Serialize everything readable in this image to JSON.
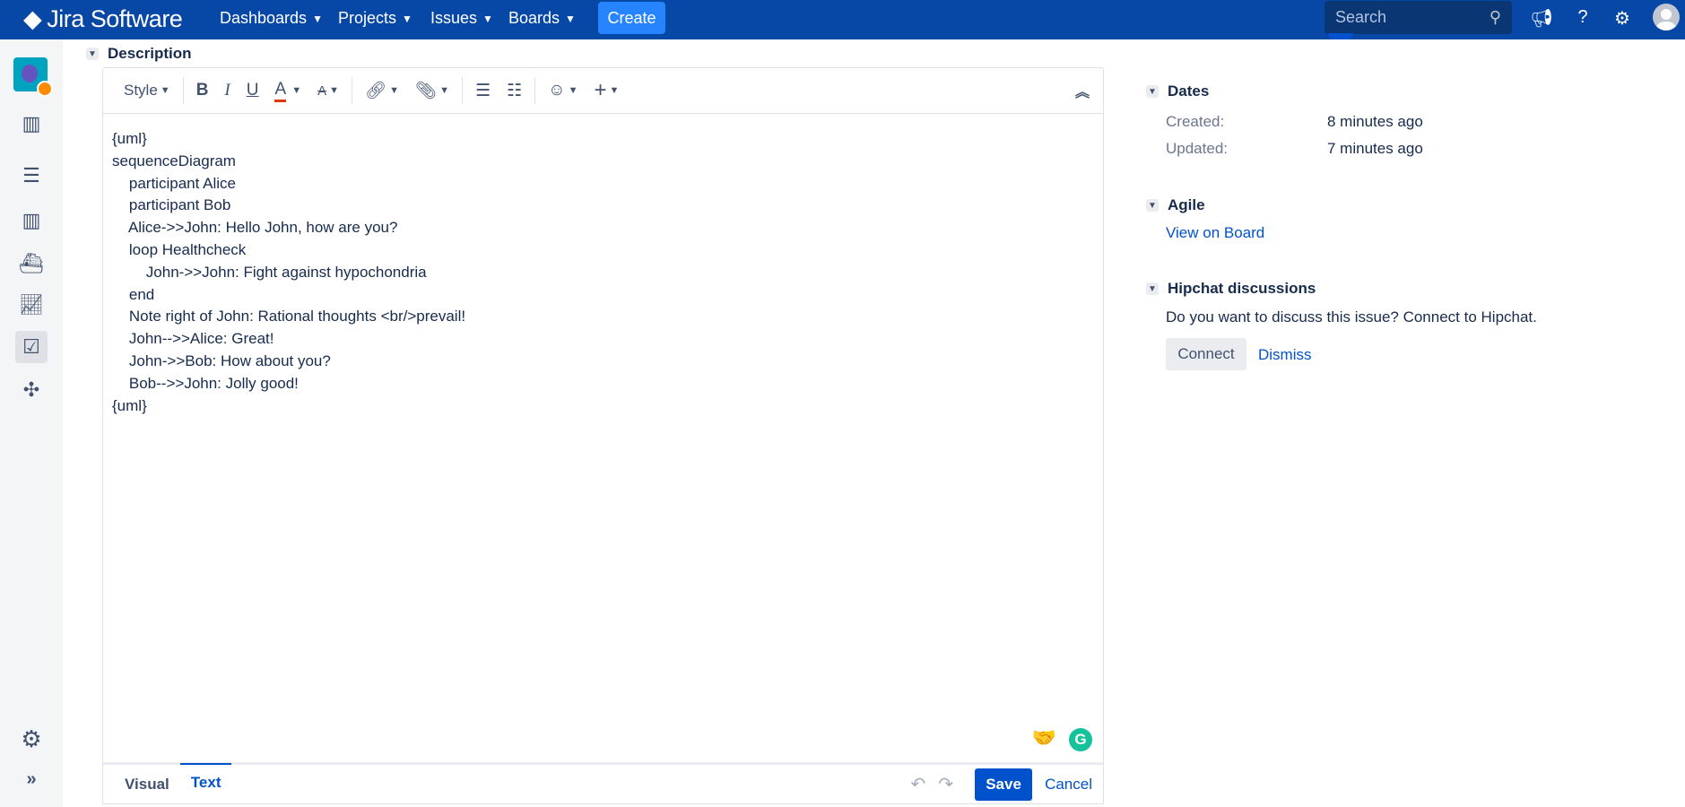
{
  "topbar": {
    "app_name": "Jira Software",
    "nav": [
      {
        "label": "Dashboards"
      },
      {
        "label": "Projects"
      },
      {
        "label": "Issues"
      },
      {
        "label": "Boards"
      }
    ],
    "create_label": "Create",
    "search_placeholder": "Search",
    "brand_color": "#0747a6"
  },
  "description": {
    "title": "Description"
  },
  "toolbar": {
    "style_label": "Style"
  },
  "editor": {
    "content": "{uml}\nsequenceDiagram\n    participant Alice\n    participant Bob\n    Alice->>John: Hello John, how are you?\n    loop Healthcheck\n        John->>John: Fight against hypochondria\n    end\n    Note right of John: Rational thoughts <br/>prevail!\n    John-->>Alice: Great!\n    John->>Bob: How about you?\n    Bob-->>John: Jolly good!\n{uml}",
    "modes": [
      "Visual",
      "Text"
    ],
    "active_mode": "Text",
    "save_label": "Save",
    "cancel_label": "Cancel"
  },
  "dates": {
    "title": "Dates",
    "created_label": "Created:",
    "created_value": "8 minutes ago",
    "updated_label": "Updated:",
    "updated_value": "7 minutes ago"
  },
  "agile": {
    "title": "Agile",
    "link": "View on Board"
  },
  "hipchat": {
    "title": "Hipchat discussions",
    "text": "Do you want to discuss this issue? Connect to Hipchat.",
    "connect_label": "Connect",
    "dismiss_label": "Dismiss"
  }
}
